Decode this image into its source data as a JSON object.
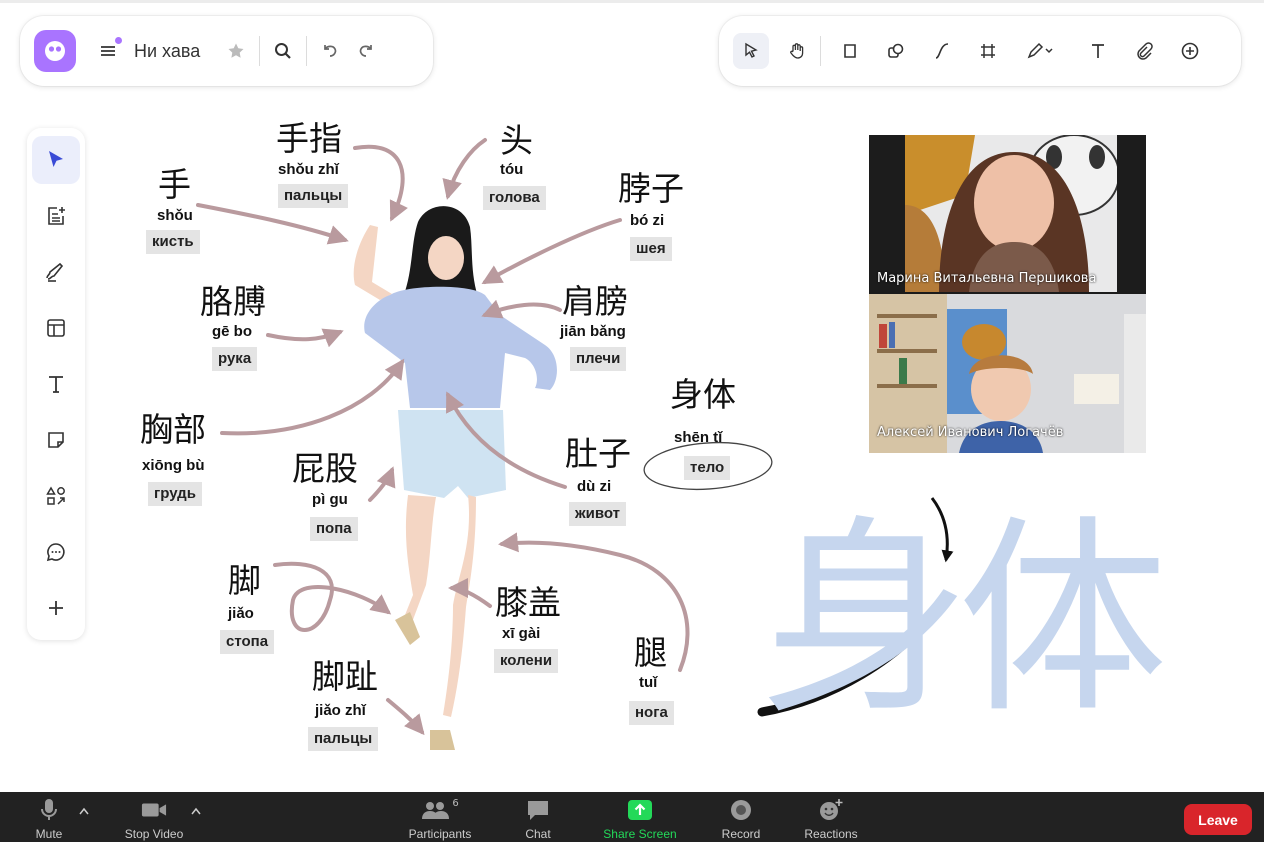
{
  "board": {
    "title": "Ни хава"
  },
  "vocab": [
    {
      "id": "hand",
      "zh": "手",
      "py": "shǒu",
      "ru": "кисть"
    },
    {
      "id": "fingers",
      "zh": "手指",
      "py": "shǒu zhǐ",
      "ru": "пальцы"
    },
    {
      "id": "head",
      "zh": "头",
      "py": "tóu",
      "ru": "голова"
    },
    {
      "id": "neck",
      "zh": "脖子",
      "py": "bó zi",
      "ru": "шея"
    },
    {
      "id": "arm",
      "zh": "胳膊",
      "py": "gē bo",
      "ru": "рука"
    },
    {
      "id": "shoulders",
      "zh": "肩膀",
      "py": "jiān bǎng",
      "ru": "плечи"
    },
    {
      "id": "body",
      "zh": "身体",
      "py": "shēn tǐ",
      "ru": "тело"
    },
    {
      "id": "chest",
      "zh": "胸部",
      "py": "xiōng bù",
      "ru": "грудь"
    },
    {
      "id": "butt",
      "zh": "屁股",
      "py": "pì gu",
      "ru": "попа"
    },
    {
      "id": "belly",
      "zh": "肚子",
      "py": "dù zi",
      "ru": "живот"
    },
    {
      "id": "foot",
      "zh": "脚",
      "py": "jiǎo",
      "ru": "стопа"
    },
    {
      "id": "knees",
      "zh": "膝盖",
      "py": "xī gài",
      "ru": "колени"
    },
    {
      "id": "leg",
      "zh": "腿",
      "py": "tuǐ",
      "ru": "нога"
    },
    {
      "id": "toes",
      "zh": "脚趾",
      "py": "jiǎo zhǐ",
      "ru": "пальцы"
    }
  ],
  "big_chars": {
    "left": "身",
    "right": "体"
  },
  "participants": [
    {
      "name": "Марина Витальевна Першикова"
    },
    {
      "name": "Алексей Иванович Логачёв"
    }
  ],
  "zoom": {
    "mute": "Mute",
    "stop_video": "Stop Video",
    "participants": "Participants",
    "participants_count": "6",
    "chat": "Chat",
    "share_screen": "Share Screen",
    "record": "Record",
    "reactions": "Reactions",
    "leave": "Leave"
  },
  "colors": {
    "accent": "#a974ff",
    "arrow": "#b99a9e",
    "big_char": "#c6d6ee",
    "share_green": "#23d959",
    "leave_red": "#d9252b",
    "shirt": "#b7c7ea"
  }
}
